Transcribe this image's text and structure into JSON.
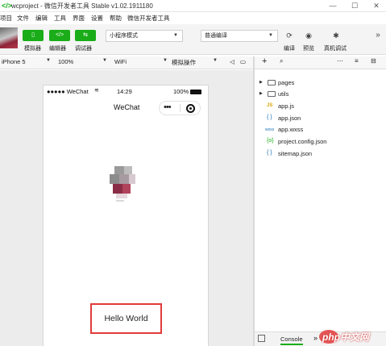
{
  "window": {
    "title": "wcproject - 微信开发者工具 Stable v1.02.1911180",
    "minimize": "—",
    "maximize": "☐",
    "close": "✕"
  },
  "menu": [
    "项目",
    "文件",
    "编辑",
    "工具",
    "界面",
    "设置",
    "帮助",
    "微信开发者工具"
  ],
  "toolbar": {
    "simulator_label": "模拟器",
    "editor_label": "编辑器",
    "debugger_label": "调试器",
    "mode_select": "小程序模式",
    "compile_select": "普通编译",
    "compile_label": "编译",
    "preview_label": "预览",
    "realdevice_label": "真机调试",
    "more": "»"
  },
  "simbar": {
    "device": "iPhone 5",
    "zoom": "100%",
    "network": "WiFi",
    "operation": "模拟操作"
  },
  "phone": {
    "carrier": "●●●●● WeChat",
    "time": "14:29",
    "battery": "100%",
    "nav_title": "WeChat",
    "hello_text": "Hello World"
  },
  "files": [
    {
      "name": "pages",
      "type": "folder"
    },
    {
      "name": "utils",
      "type": "folder"
    },
    {
      "name": "app.js",
      "type": "js"
    },
    {
      "name": "app.json",
      "type": "json"
    },
    {
      "name": "app.wxss",
      "type": "wxss"
    },
    {
      "name": "project.config.json",
      "type": "config"
    },
    {
      "name": "sitemap.json",
      "type": "json"
    }
  ],
  "bottom": {
    "console_tab": "Console",
    "more": "»"
  },
  "watermark": {
    "text": "php中文网"
  },
  "colors": {
    "accent": "#1aad19",
    "highlight": "#e23b3b"
  }
}
